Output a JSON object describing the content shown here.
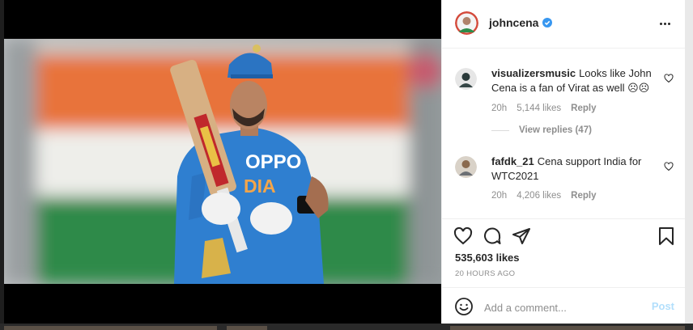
{
  "post": {
    "author": "johncena",
    "verified": true,
    "likes_text": "535,603 likes",
    "time_text": "20 HOURS AGO"
  },
  "comments": [
    {
      "username": "visualizersmusic",
      "text": "Looks like John Cena is a fan of Virat as well ☹☹",
      "age": "20h",
      "likes": "5,144 likes",
      "reply_label": "Reply",
      "view_replies": "View replies (47)"
    },
    {
      "username": "fafdk_21",
      "text": "Cena support India for WTC2021",
      "age": "20h",
      "likes": "4,206 likes",
      "reply_label": "Reply"
    }
  ],
  "add_comment": {
    "placeholder": "Add a comment...",
    "post_label": "Post"
  },
  "icons": {
    "more": "more-options-icon",
    "like": "heart-icon",
    "comment": "comment-bubble-icon",
    "share": "send-icon",
    "save": "bookmark-icon",
    "emoji": "emoji-smile-icon",
    "verified": "verified-badge-icon"
  },
  "colors": {
    "verified_blue": "#3897f0",
    "post_disabled": "#b2dffc",
    "jersey_blue": "#2f7fd0",
    "flag_saffron": "#e8733a",
    "flag_green": "#2e8a4a"
  }
}
